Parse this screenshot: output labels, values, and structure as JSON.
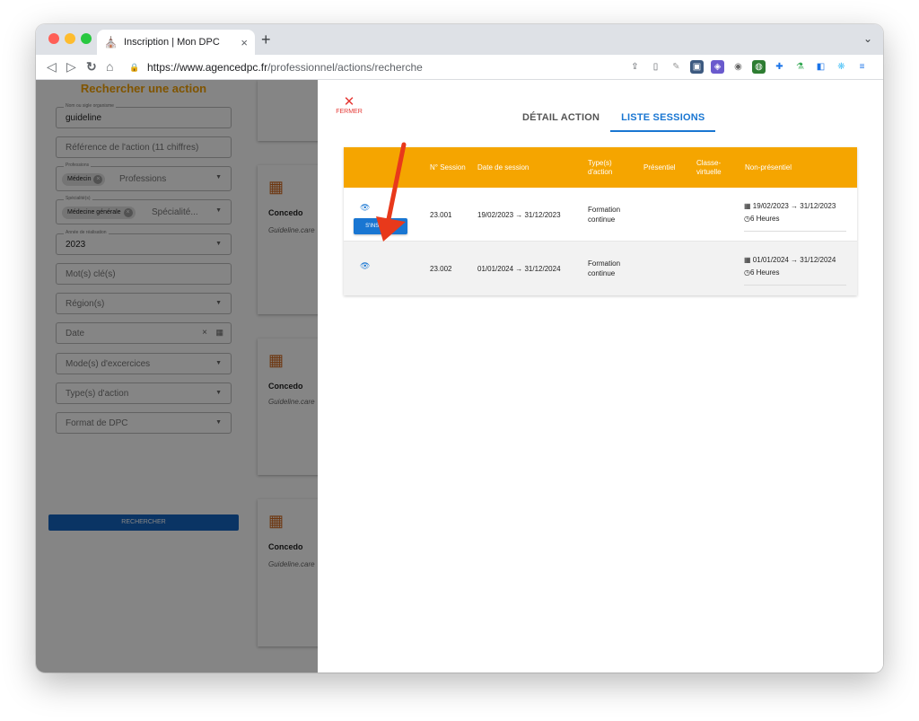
{
  "browser": {
    "tab_title": "Inscription | Mon DPC",
    "new_tab": "+",
    "tab_close": "×",
    "url_host": "https://www.agencedpc.fr",
    "url_path": "/professionnel/actions/recherche"
  },
  "search_panel": {
    "title": "Rechercher une action",
    "org_label": "Nom ou sigle organisme",
    "org_value": "guideline",
    "reference_placeholder": "Référence de l'action (11 chiffres)",
    "professions_label": "Professions",
    "professions_chip": "Médecin",
    "professions_placeholder": "Professions",
    "specialites_label": "Spécialité(s)",
    "specialites_chip": "Médecine générale",
    "specialites_placeholder": "Spécialité...",
    "annee_label": "Année de réalisation",
    "annee_value": "2023",
    "motcles_placeholder": "Mot(s) clé(s)",
    "region_placeholder": "Région(s)",
    "date_placeholder": "Date",
    "mode_placeholder": "Mode(s) d'excercices",
    "type_placeholder": "Type(s) d'action",
    "format_placeholder": "Format de DPC",
    "search_button": "RECHERCHER"
  },
  "results": [
    {
      "title": "Concedo",
      "subtitle": "Guideline.care"
    },
    {
      "title": "Concedo",
      "subtitle": "Guideline.care"
    },
    {
      "title": "Concedo",
      "subtitle": "Guideline.care"
    }
  ],
  "drawer": {
    "close_label": "FERMER",
    "tab_detail": "DÉTAIL ACTION",
    "tab_sessions": "LISTE SESSIONS",
    "table": {
      "headers": [
        "N° Session",
        "Date de session",
        "Type(s) d'action",
        "Présentiel",
        "Classe-virtuelle",
        "Non-présentiel"
      ],
      "rows": [
        {
          "session": "23.001",
          "dates": "19/02/2023 → 31/12/2023",
          "type": "Formation continue",
          "presentiel": "",
          "classe": "",
          "np_dates": "19/02/2023 → 31/12/2023",
          "np_duree": "6 Heures",
          "register": "S'INSCRIRE"
        },
        {
          "session": "23.002",
          "dates": "01/01/2024 → 31/12/2024",
          "type": "Formation continue",
          "presentiel": "",
          "classe": "",
          "np_dates": "01/01/2024 → 31/12/2024",
          "np_duree": "6 Heures"
        }
      ]
    }
  },
  "colors": {
    "accent_orange": "#f5a500",
    "primary_blue": "#1976d2",
    "close_red": "#e53935",
    "annotation_arrow": "#e8391b"
  }
}
